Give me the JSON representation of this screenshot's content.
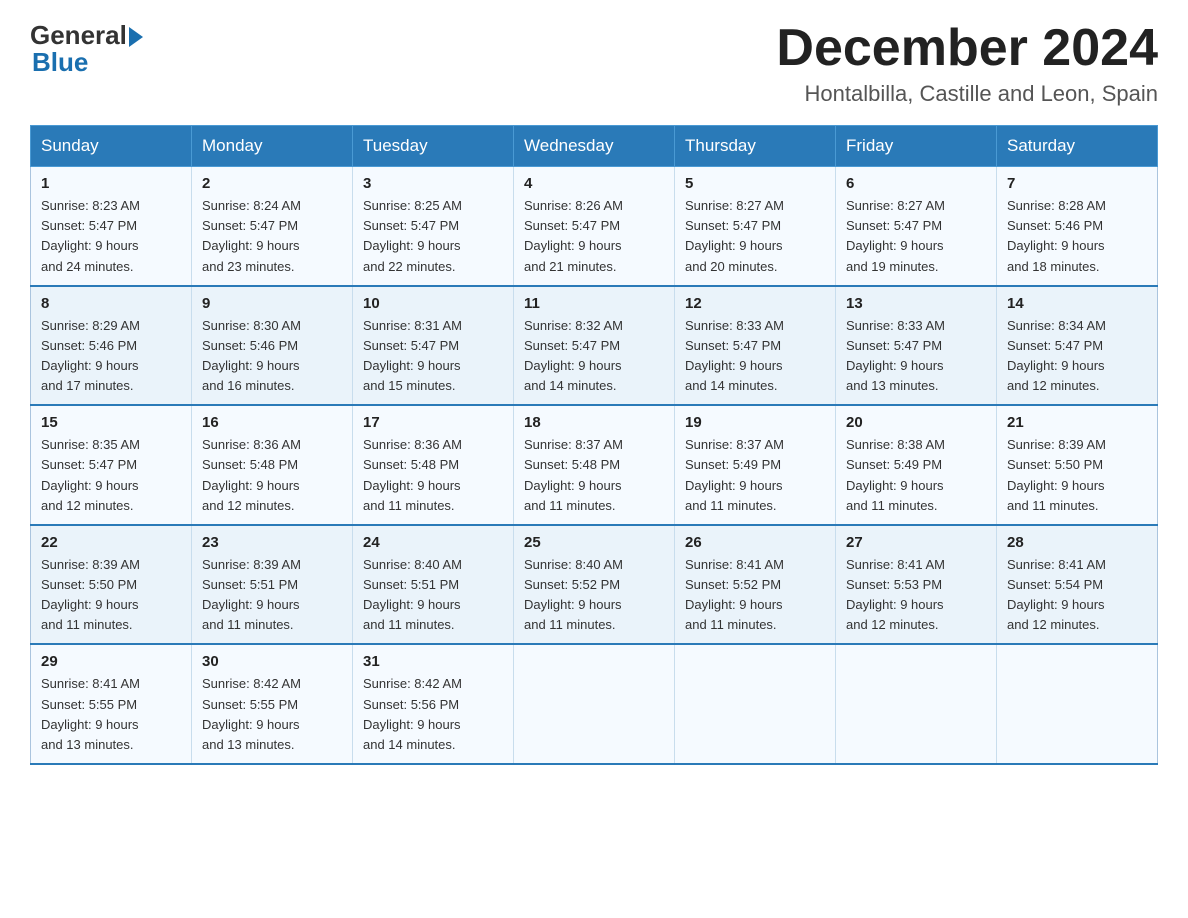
{
  "logo": {
    "general": "General",
    "blue": "Blue"
  },
  "header": {
    "month_year": "December 2024",
    "location": "Hontalbilla, Castille and Leon, Spain"
  },
  "weekdays": [
    "Sunday",
    "Monday",
    "Tuesday",
    "Wednesday",
    "Thursday",
    "Friday",
    "Saturday"
  ],
  "weeks": [
    [
      {
        "day": "1",
        "sunrise": "8:23 AM",
        "sunset": "5:47 PM",
        "daylight": "9 hours and 24 minutes."
      },
      {
        "day": "2",
        "sunrise": "8:24 AM",
        "sunset": "5:47 PM",
        "daylight": "9 hours and 23 minutes."
      },
      {
        "day": "3",
        "sunrise": "8:25 AM",
        "sunset": "5:47 PM",
        "daylight": "9 hours and 22 minutes."
      },
      {
        "day": "4",
        "sunrise": "8:26 AM",
        "sunset": "5:47 PM",
        "daylight": "9 hours and 21 minutes."
      },
      {
        "day": "5",
        "sunrise": "8:27 AM",
        "sunset": "5:47 PM",
        "daylight": "9 hours and 20 minutes."
      },
      {
        "day": "6",
        "sunrise": "8:27 AM",
        "sunset": "5:47 PM",
        "daylight": "9 hours and 19 minutes."
      },
      {
        "day": "7",
        "sunrise": "8:28 AM",
        "sunset": "5:46 PM",
        "daylight": "9 hours and 18 minutes."
      }
    ],
    [
      {
        "day": "8",
        "sunrise": "8:29 AM",
        "sunset": "5:46 PM",
        "daylight": "9 hours and 17 minutes."
      },
      {
        "day": "9",
        "sunrise": "8:30 AM",
        "sunset": "5:46 PM",
        "daylight": "9 hours and 16 minutes."
      },
      {
        "day": "10",
        "sunrise": "8:31 AM",
        "sunset": "5:47 PM",
        "daylight": "9 hours and 15 minutes."
      },
      {
        "day": "11",
        "sunrise": "8:32 AM",
        "sunset": "5:47 PM",
        "daylight": "9 hours and 14 minutes."
      },
      {
        "day": "12",
        "sunrise": "8:33 AM",
        "sunset": "5:47 PM",
        "daylight": "9 hours and 14 minutes."
      },
      {
        "day": "13",
        "sunrise": "8:33 AM",
        "sunset": "5:47 PM",
        "daylight": "9 hours and 13 minutes."
      },
      {
        "day": "14",
        "sunrise": "8:34 AM",
        "sunset": "5:47 PM",
        "daylight": "9 hours and 12 minutes."
      }
    ],
    [
      {
        "day": "15",
        "sunrise": "8:35 AM",
        "sunset": "5:47 PM",
        "daylight": "9 hours and 12 minutes."
      },
      {
        "day": "16",
        "sunrise": "8:36 AM",
        "sunset": "5:48 PM",
        "daylight": "9 hours and 12 minutes."
      },
      {
        "day": "17",
        "sunrise": "8:36 AM",
        "sunset": "5:48 PM",
        "daylight": "9 hours and 11 minutes."
      },
      {
        "day": "18",
        "sunrise": "8:37 AM",
        "sunset": "5:48 PM",
        "daylight": "9 hours and 11 minutes."
      },
      {
        "day": "19",
        "sunrise": "8:37 AM",
        "sunset": "5:49 PM",
        "daylight": "9 hours and 11 minutes."
      },
      {
        "day": "20",
        "sunrise": "8:38 AM",
        "sunset": "5:49 PM",
        "daylight": "9 hours and 11 minutes."
      },
      {
        "day": "21",
        "sunrise": "8:39 AM",
        "sunset": "5:50 PM",
        "daylight": "9 hours and 11 minutes."
      }
    ],
    [
      {
        "day": "22",
        "sunrise": "8:39 AM",
        "sunset": "5:50 PM",
        "daylight": "9 hours and 11 minutes."
      },
      {
        "day": "23",
        "sunrise": "8:39 AM",
        "sunset": "5:51 PM",
        "daylight": "9 hours and 11 minutes."
      },
      {
        "day": "24",
        "sunrise": "8:40 AM",
        "sunset": "5:51 PM",
        "daylight": "9 hours and 11 minutes."
      },
      {
        "day": "25",
        "sunrise": "8:40 AM",
        "sunset": "5:52 PM",
        "daylight": "9 hours and 11 minutes."
      },
      {
        "day": "26",
        "sunrise": "8:41 AM",
        "sunset": "5:52 PM",
        "daylight": "9 hours and 11 minutes."
      },
      {
        "day": "27",
        "sunrise": "8:41 AM",
        "sunset": "5:53 PM",
        "daylight": "9 hours and 12 minutes."
      },
      {
        "day": "28",
        "sunrise": "8:41 AM",
        "sunset": "5:54 PM",
        "daylight": "9 hours and 12 minutes."
      }
    ],
    [
      {
        "day": "29",
        "sunrise": "8:41 AM",
        "sunset": "5:55 PM",
        "daylight": "9 hours and 13 minutes."
      },
      {
        "day": "30",
        "sunrise": "8:42 AM",
        "sunset": "5:55 PM",
        "daylight": "9 hours and 13 minutes."
      },
      {
        "day": "31",
        "sunrise": "8:42 AM",
        "sunset": "5:56 PM",
        "daylight": "9 hours and 14 minutes."
      },
      null,
      null,
      null,
      null
    ]
  ],
  "labels": {
    "sunrise": "Sunrise:",
    "sunset": "Sunset:",
    "daylight": "Daylight:"
  }
}
